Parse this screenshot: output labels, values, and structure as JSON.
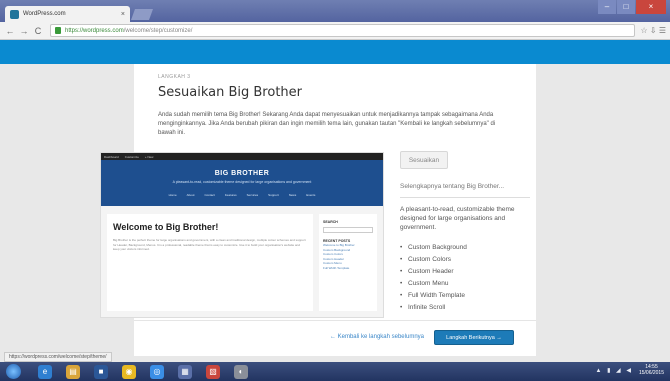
{
  "browser": {
    "tab_title": "WordPress.com",
    "tab_close": "×",
    "url_host": "https://wordpress.com",
    "url_path": "/welcome/step/customize/",
    "nav_back": "←",
    "nav_forward": "→",
    "nav_reload": "C",
    "toolbar_icons": "☆ ⇩ ☰",
    "win_minimize": "–",
    "win_maximize": "□",
    "win_close": "×"
  },
  "page": {
    "step_label": "LANGKAH 3",
    "heading": "Sesuaikan Big Brother",
    "intro": "Anda sudah memilih tema Big Brother! Sekarang Anda dapat menyesuaikan untuk menjadikannya tampak sebagaimana Anda menginginkannya. Jika Anda berubah pikiran dan ingin memilih tema lain, gunakan tautan \"Kembali ke langkah sebelumnya\" di bawah ini."
  },
  "preview": {
    "adminbar_items": [
      "Dashboard",
      "Customize",
      "+ New"
    ],
    "site_name": "BIG BROTHER",
    "tagline": "A pleasant-to-read, customizable theme designed for large organisations and government",
    "menu": [
      "Home",
      "About",
      "Contact",
      "Features",
      "Services",
      "Support",
      "News",
      "Events"
    ],
    "welcome_title": "Welcome to Big Brother!",
    "welcome_text": "Big Brother is the perfect theme for large organisations and government, with a clean and traditional design, multiple colour schemes and support for Header, Background, Menus. It is a professional, readable theme that is easy to customize. Use it to build your organisation's website and keep your visitors informed.",
    "sidebar_search_title": "SEARCH",
    "sidebar_recent_title": "RECENT POSTS",
    "sidebar_links": [
      "Welcome to Big Brother",
      "Custom Background",
      "Custom Colors",
      "Custom Header",
      "Custom Menu",
      "Full Width Template"
    ]
  },
  "sidebar": {
    "activate_label": "Sesuaikan",
    "more_label": "Selengkapnya tentang Big Brother...",
    "description": "A pleasant-to-read, customizable theme designed for large organisations and government.",
    "features": [
      "Custom Background",
      "Custom Colors",
      "Custom Header",
      "Custom Menu",
      "Full Width Template",
      "Infinite Scroll"
    ]
  },
  "footer": {
    "back_link": "← Kembali ke langkah sebelumnya",
    "next_button": "Langkah Berikutnya →"
  },
  "status_url": "https://wordpress.com/welcome/step/theme/",
  "taskbar": {
    "app_icons": [
      "e",
      "▤",
      "■",
      "◉",
      "◎",
      "▦",
      "▧",
      "◐"
    ],
    "tray_icons": "▲ ▮ ◢ ◀",
    "time": "14:55",
    "date": "15/06/2015"
  },
  "colors": {
    "accent": "#0a8ad0",
    "button": "#1d7bb8",
    "theme_header": "#1e4f8f"
  }
}
